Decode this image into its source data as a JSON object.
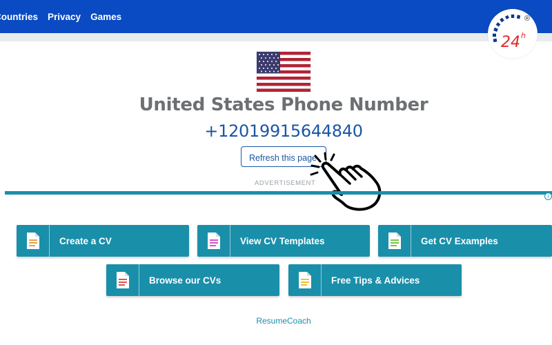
{
  "nav": {
    "items": [
      "Countries",
      "Privacy",
      "Games"
    ]
  },
  "logo": {
    "text": "24h",
    "superscript": "®"
  },
  "main": {
    "title": "United States Phone Number",
    "phone_number": "+12019915644840",
    "refresh_label": "Refresh this page"
  },
  "ad": {
    "label": "ADVERTISEMENT",
    "info_symbol": "i",
    "buttons": [
      {
        "label": "Create a CV",
        "icon": "orange-document-icon",
        "color": "#e8a04a"
      },
      {
        "label": "View CV Templates",
        "icon": "pink-document-icon",
        "color": "#d84fc9"
      },
      {
        "label": "Get CV Examples",
        "icon": "green-document-icon",
        "color": "#7ac143"
      },
      {
        "label": "Browse our CVs",
        "icon": "red-document-icon",
        "color": "#e05050"
      },
      {
        "label": "Free Tips & Advices",
        "icon": "yellow-document-icon",
        "color": "#f0c030"
      }
    ],
    "brand": "ResumeCoach",
    "accent": "#1a8faa"
  },
  "colors": {
    "header": "#0a4ac2",
    "link": "#1a56a6",
    "title": "#6c7072"
  }
}
